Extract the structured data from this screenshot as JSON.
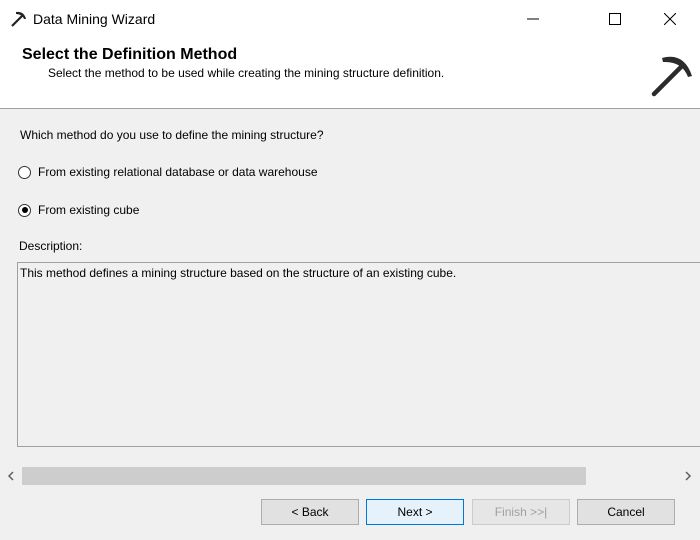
{
  "window": {
    "title": "Data Mining Wizard",
    "app_icon": "pickaxe-icon",
    "controls": [
      "minimize-icon",
      "maximize-icon",
      "close-icon"
    ]
  },
  "banner": {
    "heading": "Select the Definition Method",
    "subheading": "Select the method to be used while creating the mining structure definition.",
    "logo": "pickaxe-icon"
  },
  "main": {
    "question": "Which method do you use to define the mining structure?",
    "options": [
      {
        "label": "From existing relational database or data warehouse",
        "checked": false
      },
      {
        "label": "From existing cube",
        "checked": true
      }
    ],
    "description_label": "Description:",
    "description_text": "This method defines a mining structure based on the structure of an existing cube."
  },
  "footer": {
    "back_label": "< Back",
    "next_label": "Next >",
    "finish_label": "Finish >>|",
    "cancel_label": "Cancel"
  },
  "colors": {
    "background": "#f0f0f0",
    "accent": "#0078d7",
    "disabled_text": "#a0a0a0"
  }
}
